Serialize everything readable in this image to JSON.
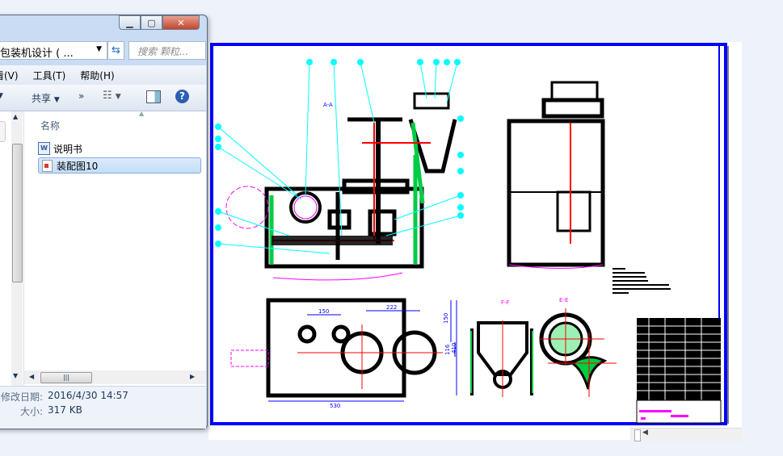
{
  "explorer": {
    "window_controls": {
      "minimize": "minimize-icon",
      "maximize": "maximize-icon",
      "close": "close-icon"
    },
    "address": "包装机设计 ( ...",
    "search_placeholder": "搜索 颗粒...",
    "menu": [
      "看(V)",
      "工具(T)",
      "帮助(H)"
    ],
    "toolbar": {
      "share": "共享",
      "more": "»"
    },
    "column_header": "名称",
    "files": [
      {
        "name": "说明书",
        "icon": "word-doc-icon",
        "selected": false
      },
      {
        "name": "装配图10",
        "icon": "image-file-icon",
        "selected": true
      }
    ],
    "details": {
      "modified_label": "修改日期:",
      "modified_value": "2016/4/30 14:57",
      "size_label": "大小:",
      "size_value": "317 KB"
    }
  },
  "drawing": {
    "section_labels": {
      "aa": "A-A",
      "ff": "F-F",
      "ee": "E-E"
    },
    "dimensions": {
      "d1": "150",
      "d2": "222",
      "d3": "530",
      "d4": "150",
      "d5": "116",
      "d6": "410"
    },
    "colors": {
      "frame": "#0000ff",
      "hatch": "#00cc44",
      "center": "#ff0000",
      "leader": "#00ffff",
      "phantom": "#ff00ff",
      "dim": "#0000ff"
    }
  }
}
